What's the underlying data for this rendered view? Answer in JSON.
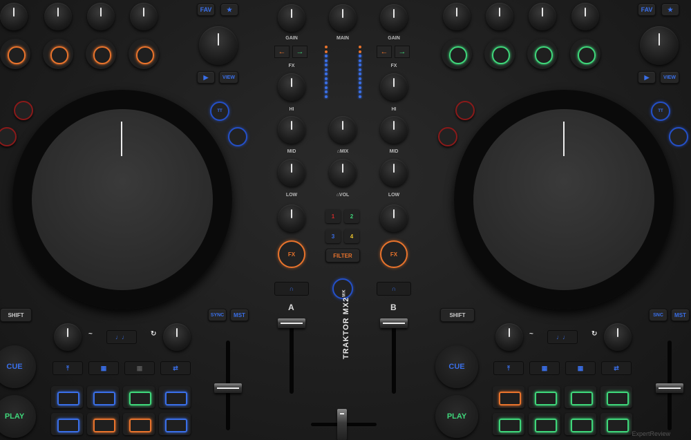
{
  "colors": {
    "orange": "#e8732c",
    "green": "#3fd67a",
    "blue": "#3a6fe8",
    "red": "#c02020",
    "red_dark": "#d02a2a"
  },
  "brand": "TRAKTOR MX2",
  "brand_super": "MK",
  "mixer": {
    "gain": "GAIN",
    "main": "MAIN",
    "fx": "FX",
    "hi": "HI",
    "mid": "MID",
    "low": "LOW",
    "mix": "⌂MIX",
    "vol": "⌂VOL",
    "filter": "FILTER",
    "fx_btn": "FX",
    "numbers": [
      "1",
      "2",
      "3",
      "4"
    ],
    "channel_a": "A",
    "channel_b": "B",
    "arrow_left": "←",
    "arrow_right": "→",
    "headphone_icon": "∩"
  },
  "deck_left": {
    "fav": "FAV",
    "star": "★",
    "play_small": "▶",
    "view": "VIEW",
    "shift": "SHIFT",
    "sync": "SYNC",
    "mst": "MST",
    "cue": "CUE",
    "play": "PLAY",
    "tt": "TT",
    "music_icon": "♩♩"
  },
  "deck_right": {
    "fav": "FAV",
    "star": "★",
    "play_small": "▶",
    "view": "VIEW",
    "shift": "SHIFT",
    "sync": "SNC",
    "mst": "MST",
    "cue": "CUE",
    "play": "PLAY",
    "tt": "TT",
    "music_icon": "♩♩"
  },
  "watermark": "ExpertReview"
}
